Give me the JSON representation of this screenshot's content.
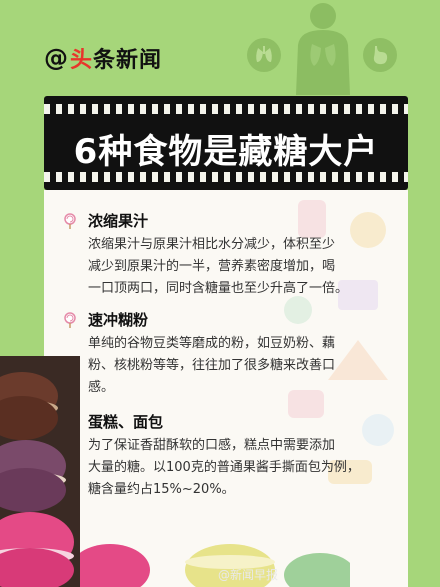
{
  "logo": {
    "at": "@",
    "brand_red": "头",
    "brand_rest": "条新闻"
  },
  "title": "6种食物是藏糖大户",
  "items": [
    {
      "title": "浓缩果汁",
      "lines": [
        "浓缩果汁与原果汁相比水分减少，体积至少",
        "减少到原果汁的一半，营养素密度增加，喝",
        "一口顶两口，同时含糖量也至少升高了一倍。"
      ]
    },
    {
      "title": "速冲糊粉",
      "lines": [
        "单纯的谷物豆类等磨成的粉，如豆奶粉、藕",
        "粉、核桃粉等等，往往加了很多糖来改善口",
        "感。"
      ]
    },
    {
      "title": "蛋糕、面包",
      "lines": [
        "为了保证香甜酥软的口感，糕点中需要添加",
        "大量的糖。以100克的普通果酱手撕面包为例，",
        "糖含量约占15%~20%。"
      ]
    }
  ],
  "watermark": "@新闻早报",
  "icons": [
    "lollipop-icon",
    "lungs-icon",
    "stomach-icon",
    "body-silhouette-icon"
  ],
  "colors": {
    "background": "#a6d67a",
    "title_box": "#111111",
    "card": "#fbf9f4",
    "accent_red": "#e8352b"
  }
}
